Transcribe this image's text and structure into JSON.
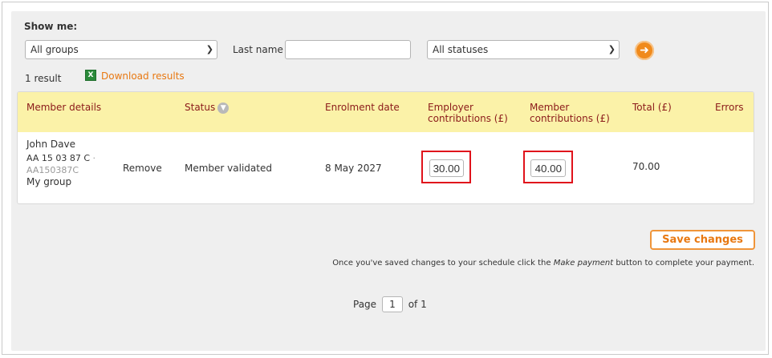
{
  "filters": {
    "show_me_label": "Show me:",
    "group_select": "All groups",
    "last_name_label": "Last name",
    "last_name_value": "",
    "status_select": "All statuses",
    "go_icon": "arrow-right-icon"
  },
  "results": {
    "count": "1 result",
    "download_label": "Download results"
  },
  "table": {
    "headers": {
      "member": "Member details",
      "status": "Status",
      "enrolment": "Enrolment date",
      "employer_line1": "Employer",
      "employer_line2": "contributions (£)",
      "member_line1": "Member",
      "member_line2": "contributions (£)",
      "total": "Total (£)",
      "errors": "Errors"
    },
    "rows": [
      {
        "name": "John Dave",
        "ni_number": "AA 15 03 87 C",
        "ni_sep": "·",
        "ni_ref": "AA150387C",
        "group": "My group",
        "remove": "Remove",
        "status": "Member validated",
        "enrolment": "8 May 2027",
        "employer_contribution": "30.00",
        "member_contribution": "40.00",
        "total": "70.00",
        "errors": ""
      }
    ]
  },
  "actions": {
    "save_label": "Save changes",
    "note_before": "Once you've saved changes to your schedule click the ",
    "note_emph": "Make payment",
    "note_after": " button to complete your payment."
  },
  "pagination": {
    "page_label": "Page",
    "current": "1",
    "of_label": "of 1"
  },
  "colors": {
    "accent": "#e87811",
    "header_bg": "#fbf2a8",
    "header_text": "#8b1a1a",
    "highlight": "#e0121b"
  }
}
